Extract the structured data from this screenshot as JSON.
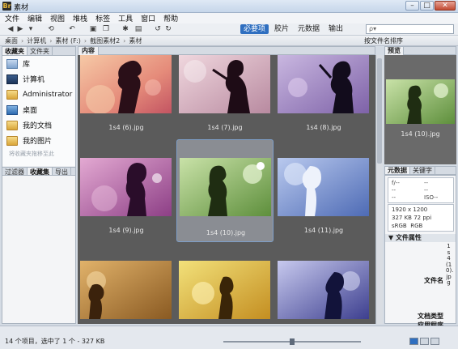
{
  "window": {
    "title": "素材"
  },
  "menu": [
    "文件",
    "编辑",
    "视图",
    "堆栈",
    "标签",
    "工具",
    "窗口",
    "帮助"
  ],
  "workspaces": [
    {
      "label": "必要项",
      "active": true
    },
    {
      "label": "胶片",
      "active": false
    },
    {
      "label": "元数据",
      "active": false
    },
    {
      "label": "输出",
      "active": false
    }
  ],
  "search": {
    "placeholder": "ρ▾"
  },
  "breadcrumb": [
    "桌面",
    "计算机",
    "素材 (F:)",
    "截图素材2",
    "素材"
  ],
  "sort_label": "按文件名排序",
  "left_panel": {
    "tabs": [
      "收藏夹",
      "文件夹"
    ],
    "favorites": [
      {
        "label": "库",
        "icon": "library-icon"
      },
      {
        "label": "计算机",
        "icon": "computer-icon"
      },
      {
        "label": "Administrator",
        "icon": "folder-icon"
      },
      {
        "label": "桌面",
        "icon": "desktop-icon"
      },
      {
        "label": "我的文档",
        "icon": "folder-icon"
      },
      {
        "label": "我的图片",
        "icon": "folder-icon"
      }
    ],
    "hint": "将收藏夹拖移至此",
    "bottom_tabs": [
      "过滤器",
      "收藏集",
      "导出"
    ]
  },
  "content": {
    "tab": "内容",
    "items": [
      {
        "caption": "1s4 (6).jpg"
      },
      {
        "caption": "1s4 (7).jpg"
      },
      {
        "caption": "1s4 (8).jpg"
      },
      {
        "caption": "1s4 (9).jpg"
      },
      {
        "caption": "1s4 (10).jpg"
      },
      {
        "caption": "1s4 (11).jpg"
      },
      {
        "caption": ""
      },
      {
        "caption": ""
      },
      {
        "caption": ""
      }
    ]
  },
  "preview": {
    "tab": "预览",
    "caption": "1s4 (10).jpg"
  },
  "metadata": {
    "tabs": [
      "元数据",
      "关键字"
    ],
    "camera": {
      "c1": "f/--",
      "c2": "--",
      "c3": "--",
      "c4": "--",
      "c5": "--",
      "c6": "ISO--"
    },
    "image_info": {
      "dims": "1920 x 1200",
      "size": "327 KB",
      "ppi": "72 ppi",
      "c1": "sRGB",
      "c2": "RGB"
    },
    "section": "文件属性",
    "fields": [
      "文件名",
      "文档类型",
      "应用程序"
    ],
    "filename_vertical": "1s4(10).jpg"
  },
  "status": {
    "text": "14 个项目，选中了 1 个 - 327 KB"
  }
}
